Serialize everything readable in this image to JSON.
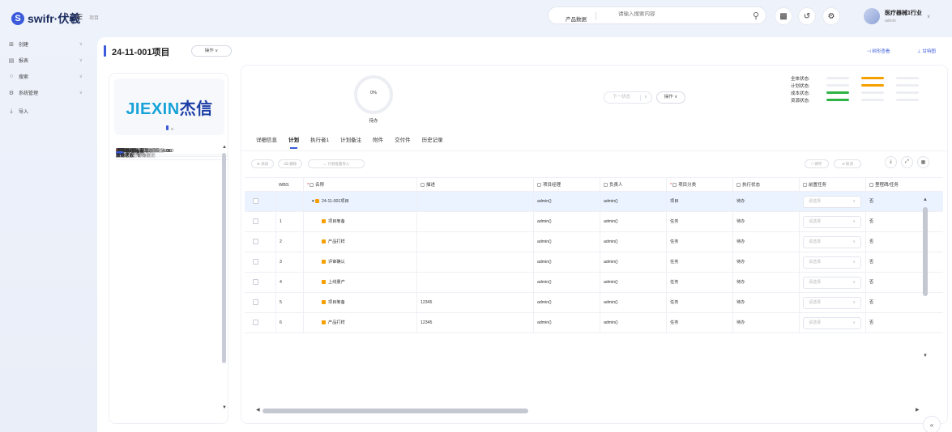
{
  "topbar": {
    "logo_text": "swifr·伏羲",
    "breadcrumb": "项目",
    "product_data": "产品数据",
    "search_placeholder": "请输入搜索内容",
    "user_name": "医疗器械1行业",
    "user_role": "admin"
  },
  "sidebar": {
    "items": [
      {
        "label": "创建",
        "icon": "plus-square-icon"
      },
      {
        "label": "报表",
        "icon": "report-icon"
      },
      {
        "label": "搜索",
        "icon": "search-icon"
      },
      {
        "label": "系统管理",
        "icon": "gear-icon"
      },
      {
        "label": "导入",
        "icon": "import-icon"
      }
    ]
  },
  "header": {
    "title": "24-11-001项目",
    "op_label": "操作",
    "link_tree": "树形查看",
    "link_gantt": "甘特图"
  },
  "leftpanel": {
    "brand_prefix": "JIEXIN",
    "brand_suffix": "杰信",
    "info": [
      {
        "label": "计划开始日期:",
        "value": "2024-11-01",
        "req": true,
        "empty": false
      },
      {
        "label": "计划结束日期:",
        "value": "2025-04-30",
        "req": true,
        "empty": false
      },
      {
        "label": "计划持续时间（天）:",
        "value": "129.0",
        "req": true,
        "empty": false
      },
      {
        "label": "实际开始日期:",
        "value": "暂无数据",
        "req": false,
        "empty": true
      },
      {
        "label": "实际结束日期:",
        "value": "暂无数据",
        "req": false,
        "empty": true
      },
      {
        "label": "实际持续时间:",
        "value": "暂无数据",
        "req": false,
        "empty": true
      },
      {
        "label": "完成率:",
        "value": "0%",
        "req": false,
        "empty": false
      },
      {
        "label": "编号:",
        "value": "PRJ000029",
        "req": false,
        "empty": false
      },
      {
        "label": "实际开始偏差:",
        "value": "暂无数据",
        "req": false,
        "empty": true
      },
      {
        "label": "实际结束偏差:",
        "value": "暂无数据",
        "req": false,
        "empty": true
      },
      {
        "label": "实际持续偏差:",
        "value": "暂无数据",
        "req": false,
        "empty": true
      },
      {
        "label": "项目分类:",
        "value": "项目",
        "req": true,
        "empty": false
      },
      {
        "label": "项目经理:",
        "value": "admin();",
        "req": false,
        "empty": false
      },
      {
        "label": "负责人:",
        "value": "admin();",
        "req": false,
        "empty": false
      },
      {
        "label": "名称:",
        "value": "24-11-001项目",
        "req": true,
        "empty": false
      },
      {
        "label": "描述:",
        "value": "暂无数据",
        "req": false,
        "empty": true
      },
      {
        "label": "根项目:",
        "value": "暂无数据",
        "req": false,
        "empty": true
      },
      {
        "label": "父项目对象:",
        "value": "暂无数据",
        "req": false,
        "empty": true
      },
      {
        "label": "项目状态:",
        "value": "起草",
        "req": true,
        "empty": false
      },
      {
        "label": "累计日期:",
        "value": "是",
        "req": true,
        "empty": false
      }
    ],
    "status_section": "状态信息",
    "status_info": [
      {
        "label": "执行状态:",
        "value": "待办",
        "empty": false
      },
      {
        "label": "风险等:",
        "value": "暂无数据",
        "empty": true
      },
      {
        "label": "计划状态:",
        "value": "暂无数据",
        "empty": true
      },
      {
        "label": "总体状态:",
        "value": "暂无数据",
        "empty": true
      },
      {
        "label": "启动次数:",
        "value": "0",
        "empty": false
      }
    ]
  },
  "overview": {
    "progress_text": "0%",
    "progress_fraction": 0,
    "progress_label": "待办",
    "next_state_placeholder": "下一状态",
    "op_label": "操作",
    "status_rows": [
      {
        "label": "全体状态:",
        "color": "#f59f00"
      },
      {
        "label": "计划状态:",
        "color": "#f59f00"
      },
      {
        "label": "成本状态:",
        "color": "#2fb344"
      },
      {
        "label": "资源状态:",
        "color": "#2fb344"
      }
    ]
  },
  "tabs": [
    "详细信息",
    "计划",
    "执行者1",
    "计划备注",
    "附件",
    "交付件",
    "历史记录"
  ],
  "actions": {
    "add": "添加",
    "delete": "删除",
    "batch_import": "计划批量导入",
    "save": "保存",
    "cancel": "取消"
  },
  "grid": {
    "headers": [
      "WBS",
      "名称",
      "描述",
      "项目经理",
      "负责人",
      "项目分类",
      "执行状态",
      "前置任务",
      "里程碑/任务"
    ],
    "select_placeholder": "请选择",
    "rows": [
      {
        "wbs": "",
        "name": "24-11-001项目",
        "desc": "",
        "pm": "admin()",
        "owner": "admin()",
        "cat": "项目",
        "exec": "待办",
        "mile": "否",
        "root": true
      },
      {
        "wbs": "1",
        "name": "项目筹备",
        "desc": "",
        "pm": "admin()",
        "owner": "admin()",
        "cat": "任务",
        "exec": "待办",
        "mile": "否",
        "root": false
      },
      {
        "wbs": "2",
        "name": "产品打样",
        "desc": "",
        "pm": "admin()",
        "owner": "admin()",
        "cat": "任务",
        "exec": "待办",
        "mile": "否",
        "root": false
      },
      {
        "wbs": "3",
        "name": "评审确认",
        "desc": "",
        "pm": "admin()",
        "owner": "admin()",
        "cat": "任务",
        "exec": "待办",
        "mile": "否",
        "root": false
      },
      {
        "wbs": "4",
        "name": "上线量产",
        "desc": "",
        "pm": "admin()",
        "owner": "admin()",
        "cat": "任务",
        "exec": "待办",
        "mile": "否",
        "root": false
      },
      {
        "wbs": "5",
        "name": "项目筹备",
        "desc": "12345",
        "pm": "admin()",
        "owner": "admin()",
        "cat": "任务",
        "exec": "待办",
        "mile": "否",
        "root": false
      },
      {
        "wbs": "6",
        "name": "产品打样",
        "desc": "12345",
        "pm": "admin()",
        "owner": "admin()",
        "cat": "任务",
        "exec": "待办",
        "mile": "否",
        "root": false
      }
    ]
  }
}
